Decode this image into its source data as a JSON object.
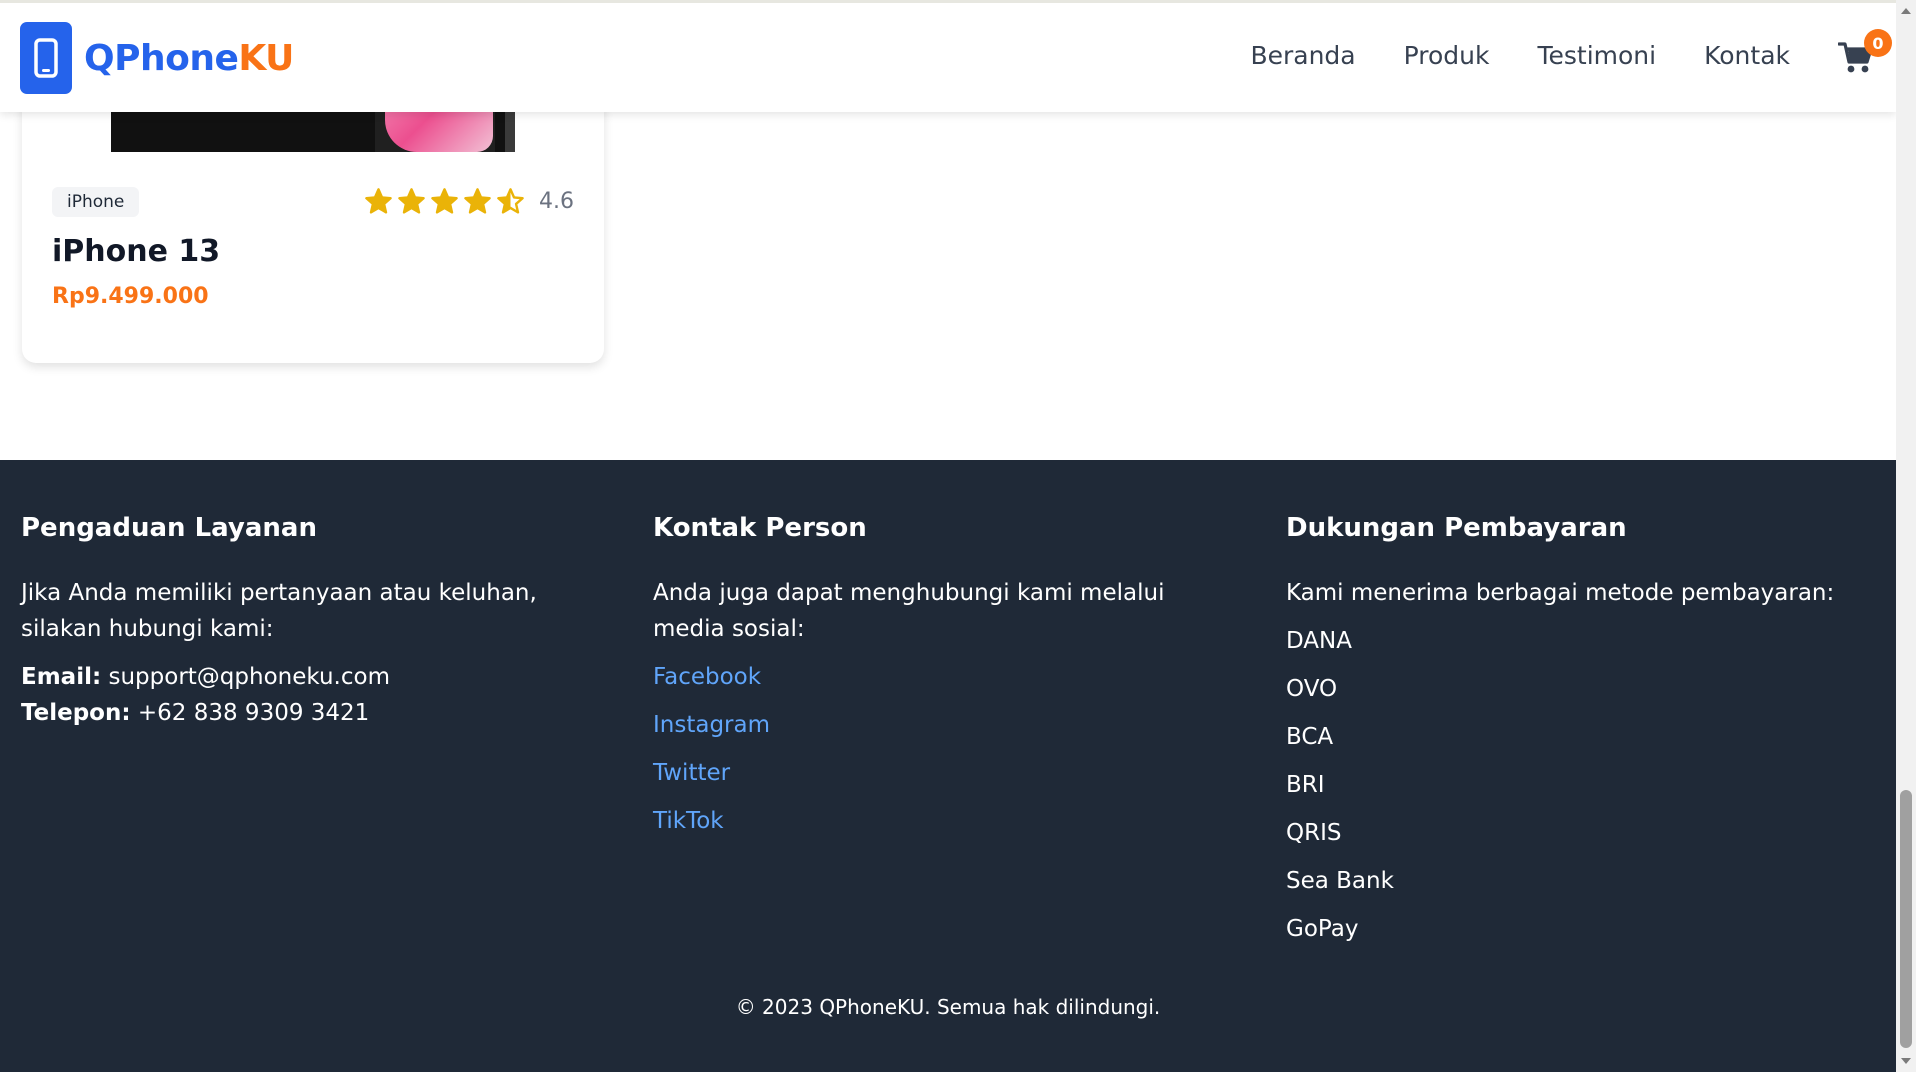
{
  "header": {
    "brand_part1": "QPhone",
    "brand_part2": "KU",
    "nav": [
      "Beranda",
      "Produk",
      "Testimoni",
      "Kontak"
    ],
    "cart_count": "0",
    "colors": {
      "primary": "#2563eb",
      "accent": "#f97316"
    }
  },
  "product": {
    "category": "iPhone",
    "name": "iPhone 13",
    "price": "Rp9.499.000",
    "rating": "4.6",
    "rating_value": 4.6,
    "stars_max": 5
  },
  "footer": {
    "col1": {
      "title": "Pengaduan Layanan",
      "desc": "Jika Anda memiliki pertanyaan atau keluhan, silakan hubungi kami:",
      "email_label": "Email:",
      "email": "support@qphoneku.com",
      "phone_label": "Telepon:",
      "phone": "+62 838 9309 3421"
    },
    "col2": {
      "title": "Kontak Person",
      "desc": "Anda juga dapat menghubungi kami melalui media sosial:",
      "links": [
        "Facebook",
        "Instagram",
        "Twitter",
        "TikTok"
      ]
    },
    "col3": {
      "title": "Dukungan Pembayaran",
      "desc": "Kami menerima berbagai metode pembayaran:",
      "methods": [
        "DANA",
        "OVO",
        "BCA",
        "BRI",
        "QRIS",
        "Sea Bank",
        "GoPay"
      ]
    },
    "copyright": "© 2023 QPhoneKU. Semua hak dilindungi."
  }
}
